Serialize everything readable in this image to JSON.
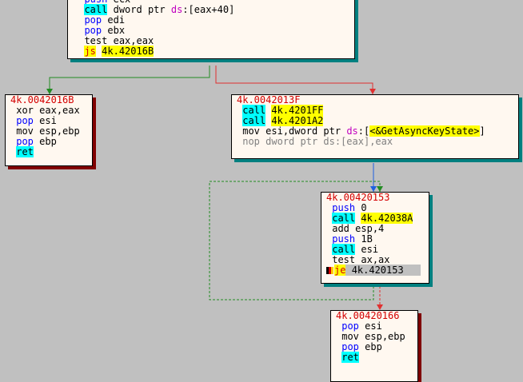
{
  "blocks": [
    {
      "id": "top",
      "header": "",
      "lines": [
        {
          "m": "push",
          "ops": [
            {
              "t": "ecx",
              "c": "plain"
            }
          ]
        },
        {
          "m": "call",
          "ops": [
            {
              "t": "dword ptr ",
              "c": "plain"
            },
            {
              "t": "ds",
              "c": "seg"
            },
            {
              "t": ":[eax+40]",
              "c": "plain"
            }
          ]
        },
        {
          "m": "pop",
          "ops": [
            {
              "t": "edi",
              "c": "plain"
            }
          ]
        },
        {
          "m": "pop",
          "ops": [
            {
              "t": "ebx",
              "c": "plain"
            }
          ]
        },
        {
          "m": "test",
          "ops": [
            {
              "t": "eax,eax",
              "c": "plain"
            }
          ]
        },
        {
          "m": "js",
          "ops": [
            {
              "t": "4k.42016B",
              "c": "hl"
            }
          ]
        }
      ]
    },
    {
      "id": "b016b",
      "header": "4k.0042016B",
      "lines": [
        {
          "m": "xor",
          "ops": [
            {
              "t": "eax,eax",
              "c": "plain"
            }
          ]
        },
        {
          "m": "pop",
          "ops": [
            {
              "t": "esi",
              "c": "plain"
            }
          ]
        },
        {
          "m": "mov",
          "ops": [
            {
              "t": "esp,ebp",
              "c": "plain"
            }
          ]
        },
        {
          "m": "pop",
          "ops": [
            {
              "t": "ebp",
              "c": "plain"
            }
          ]
        },
        {
          "m": "ret",
          "ops": []
        }
      ]
    },
    {
      "id": "b013f",
      "header": "4k.0042013F",
      "lines": [
        {
          "m": "call",
          "ops": [
            {
              "t": "4k.4201FF",
              "c": "hl"
            }
          ]
        },
        {
          "m": "call",
          "ops": [
            {
              "t": "4k.4201A2",
              "c": "hl"
            }
          ]
        },
        {
          "m": "mov",
          "ops": [
            {
              "t": "esi,dword ptr ",
              "c": "plain"
            },
            {
              "t": "ds",
              "c": "seg"
            },
            {
              "t": ":[",
              "c": "plain"
            },
            {
              "t": "<&GetAsyncKeyState>",
              "c": "hl"
            },
            {
              "t": "]",
              "c": "plain"
            }
          ]
        },
        {
          "m": "nop",
          "dim": true,
          "ops": [
            {
              "t": "dword ptr ds:[eax],eax",
              "c": "plain"
            }
          ]
        }
      ]
    },
    {
      "id": "b0153",
      "header": "4k.00420153",
      "lines": [
        {
          "m": "push",
          "ops": [
            {
              "t": "0",
              "c": "plain"
            }
          ]
        },
        {
          "m": "call",
          "ops": [
            {
              "t": "4k.42038A",
              "c": "hl"
            }
          ]
        },
        {
          "m": "add",
          "ops": [
            {
              "t": "esp,4",
              "c": "plain"
            }
          ]
        },
        {
          "m": "push",
          "ops": [
            {
              "t": "1B",
              "c": "plain"
            }
          ]
        },
        {
          "m": "call",
          "ops": [
            {
              "t": "esi",
              "c": "plain"
            }
          ]
        },
        {
          "m": "test",
          "ops": [
            {
              "t": "ax,ax",
              "c": "plain"
            }
          ]
        },
        {
          "m": "je",
          "bp": true,
          "cur": true,
          "ops": [
            {
              "t": "4k.420153",
              "c": "plain"
            }
          ]
        }
      ]
    },
    {
      "id": "b0166",
      "header": "4k.00420166",
      "lines": [
        {
          "m": "pop",
          "ops": [
            {
              "t": "esi",
              "c": "plain"
            }
          ]
        },
        {
          "m": "mov",
          "ops": [
            {
              "t": "esp,ebp",
              "c": "plain"
            }
          ]
        },
        {
          "m": "pop",
          "ops": [
            {
              "t": "ebp",
              "c": "plain"
            }
          ]
        },
        {
          "m": "ret",
          "ops": []
        }
      ]
    }
  ],
  "edge_colors": {
    "taken": "#228b22",
    "not_taken": "#e03030",
    "unconditional": "#1e60e0",
    "loop": "#228b22"
  },
  "shadow_colors": {
    "teal": "#008080",
    "maroon": "#800000"
  }
}
